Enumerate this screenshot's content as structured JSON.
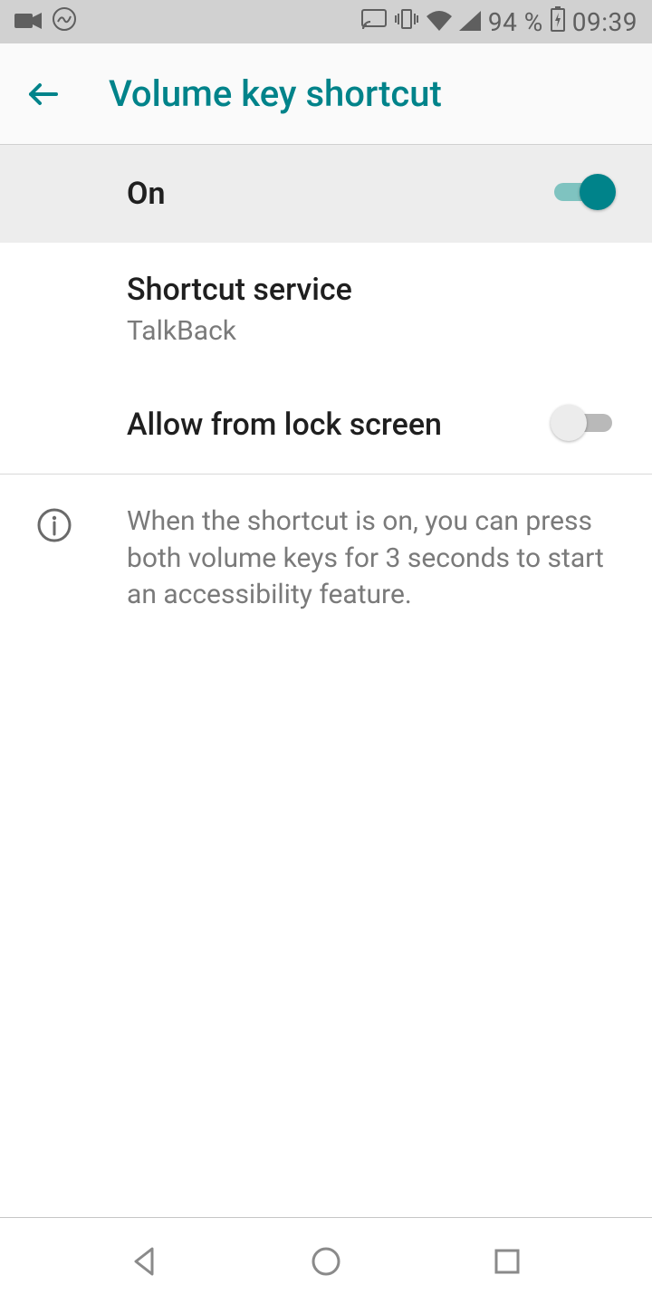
{
  "status": {
    "battery_pct": "94 %",
    "time": "09:39"
  },
  "header": {
    "title": "Volume key shortcut"
  },
  "main_toggle": {
    "label": "On",
    "value": true
  },
  "shortcut_service": {
    "label": "Shortcut service",
    "value": "TalkBack"
  },
  "lock_screen": {
    "label": "Allow from lock screen",
    "value": false
  },
  "info": {
    "text": "When the shortcut is on, you can press both volume keys for 3 seconds to start an accessibility feature."
  }
}
